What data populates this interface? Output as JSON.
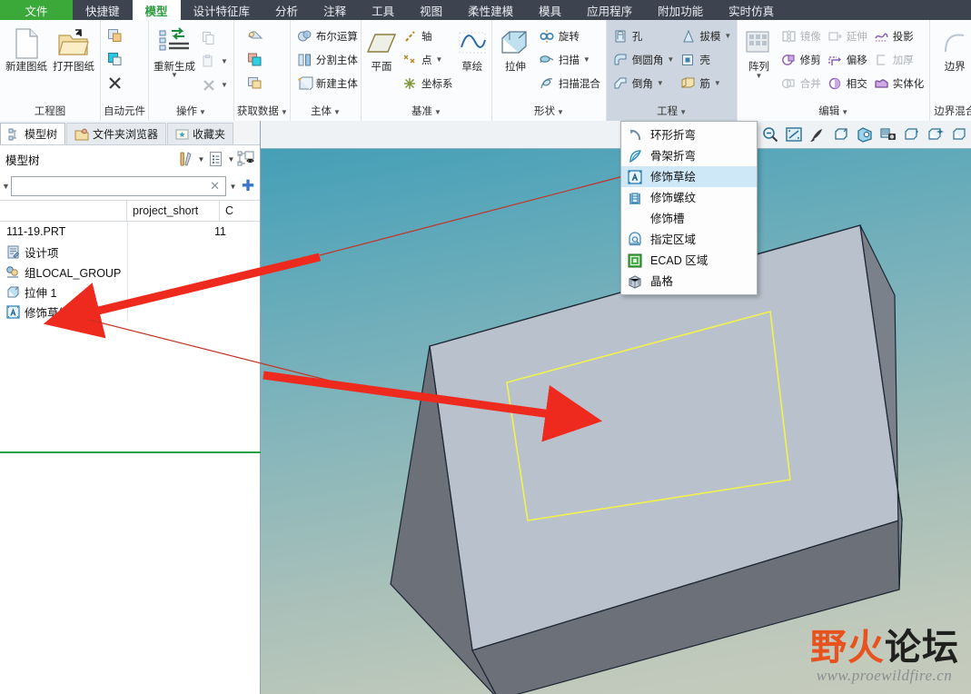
{
  "tabs": [
    {
      "label": "文件",
      "kind": "file"
    },
    {
      "label": "快捷键",
      "kind": "normal"
    },
    {
      "label": "模型",
      "kind": "active"
    },
    {
      "label": "设计特征库",
      "kind": "normal"
    },
    {
      "label": "分析",
      "kind": "normal"
    },
    {
      "label": "注释",
      "kind": "normal"
    },
    {
      "label": "工具",
      "kind": "normal"
    },
    {
      "label": "视图",
      "kind": "normal"
    },
    {
      "label": "柔性建模",
      "kind": "normal"
    },
    {
      "label": "模具",
      "kind": "normal"
    },
    {
      "label": "应用程序",
      "kind": "normal"
    },
    {
      "label": "附加功能",
      "kind": "normal"
    },
    {
      "label": "实时仿真",
      "kind": "normal"
    }
  ],
  "ribbon": {
    "groups": [
      {
        "name": "工程图",
        "caret": false,
        "big": [
          {
            "label": "新建图纸",
            "icon": "new-drawing-icon"
          },
          {
            "label": "打开图纸",
            "icon": "open-drawing-icon"
          }
        ]
      },
      {
        "name": "自动元件",
        "caret": false,
        "small": [
          {
            "label": "",
            "icon": "auto-place-icon"
          },
          {
            "label": "",
            "icon": "auto-create-icon"
          },
          {
            "label": "",
            "icon": "delete-x-icon"
          }
        ]
      },
      {
        "name": "操作",
        "caret": true,
        "small": [
          {
            "label": "重新生成",
            "icon": "regenerate-icon"
          }
        ],
        "small2": [
          {
            "label": "",
            "icon": "copy-icon",
            "disabled": true
          },
          {
            "label": "",
            "icon": "paste-icon",
            "disabled": true,
            "caret": true
          },
          {
            "label": "",
            "icon": "delete-x-icon",
            "disabled": true,
            "caret": true
          }
        ]
      },
      {
        "name": "获取数据",
        "caret": true,
        "small": [
          {
            "label": "",
            "icon": "get-data-1-icon"
          },
          {
            "label": "",
            "icon": "get-data-2-icon"
          },
          {
            "label": "",
            "icon": "get-data-3-icon"
          }
        ]
      },
      {
        "name": "主体",
        "caret": true,
        "small": [
          {
            "label": "布尔运算",
            "icon": "boolean-icon"
          },
          {
            "label": "分割主体",
            "icon": "split-body-icon"
          },
          {
            "label": "新建主体",
            "icon": "new-body-icon"
          }
        ]
      },
      {
        "name": "基准",
        "caret": true,
        "big": [
          {
            "label": "平面",
            "icon": "datum-plane-icon"
          }
        ],
        "small": [
          {
            "label": "轴",
            "icon": "datum-axis-icon"
          },
          {
            "label": "点",
            "icon": "datum-point-icon",
            "caret": true
          },
          {
            "label": "坐标系",
            "icon": "datum-csys-icon"
          }
        ],
        "big2": [
          {
            "label": "草绘",
            "icon": "sketch-icon"
          }
        ]
      },
      {
        "name": "形状",
        "caret": true,
        "big": [
          {
            "label": "拉伸",
            "icon": "extrude-icon"
          }
        ],
        "small": [
          {
            "label": "旋转",
            "icon": "revolve-icon"
          },
          {
            "label": "扫描",
            "icon": "sweep-icon",
            "caret": true
          },
          {
            "label": "扫描混合",
            "icon": "swept-blend-icon"
          }
        ]
      },
      {
        "name": "工程",
        "caret": true,
        "highlight": true,
        "small": [
          {
            "label": "孔",
            "icon": "hole-icon"
          },
          {
            "label": "倒圆角",
            "icon": "round-icon",
            "caret": true
          },
          {
            "label": "倒角",
            "icon": "chamfer-icon",
            "caret": true
          }
        ],
        "small2": [
          {
            "label": "拔模",
            "icon": "draft-icon",
            "caret": true
          },
          {
            "label": "壳",
            "icon": "shell-icon"
          },
          {
            "label": "筋",
            "icon": "rib-icon",
            "caret": true
          }
        ]
      },
      {
        "name": "编辑",
        "caret": true,
        "big": [
          {
            "label": "阵列",
            "icon": "pattern-icon",
            "caret": true
          }
        ],
        "small": [
          {
            "label": "镜像",
            "icon": "mirror-icon",
            "disabled": true
          },
          {
            "label": "修剪",
            "icon": "trim-icon"
          },
          {
            "label": "合并",
            "icon": "merge-icon",
            "disabled": true
          }
        ],
        "small2": [
          {
            "label": "延伸",
            "icon": "extend-icon",
            "disabled": true
          },
          {
            "label": "偏移",
            "icon": "offset-icon"
          },
          {
            "label": "相交",
            "icon": "intersect-icon"
          }
        ],
        "small3": [
          {
            "label": "投影",
            "icon": "project-icon"
          },
          {
            "label": "加厚",
            "icon": "thicken-icon",
            "disabled": true
          },
          {
            "label": "实体化",
            "icon": "solidify-icon"
          }
        ]
      },
      {
        "name": "边界混合",
        "caret": false,
        "big": [
          {
            "label": "边界",
            "icon": "boundary-blend-icon"
          }
        ]
      }
    ]
  },
  "leftpanel": {
    "tabs": [
      {
        "label": "模型树",
        "icon": "model-tree-icon",
        "active": true
      },
      {
        "label": "文件夹浏览器",
        "icon": "folder-browser-icon",
        "active": false
      },
      {
        "label": "收藏夹",
        "icon": "favorites-icon",
        "active": false
      }
    ],
    "header_title": "模型树",
    "tools": [
      {
        "name": "settings-tools-icon",
        "caret": true
      },
      {
        "name": "display-list-icon",
        "caret": true
      },
      {
        "name": "tree-filters-icon",
        "caret": false
      }
    ],
    "filter": {
      "value": "",
      "placeholder": ""
    },
    "columns": [
      "",
      "project_short",
      "C"
    ],
    "rows": [
      {
        "label": "111-19.PRT",
        "icon": "part-file-icon",
        "value": "11",
        "root": true
      },
      {
        "label": "设计项",
        "icon": "design-items-icon",
        "value": ""
      },
      {
        "label": "组LOCAL_GROUP",
        "icon": "group-icon",
        "value": ""
      },
      {
        "label": "拉伸 1",
        "icon": "extrude-feature-icon",
        "value": ""
      },
      {
        "label": "修饰草绘 1",
        "icon": "cosmetic-sketch-icon",
        "value": ""
      }
    ]
  },
  "graphics_toolbar": {
    "buttons": [
      {
        "name": "zoom-in-icon"
      },
      {
        "name": "zoom-out-icon"
      },
      {
        "name": "refit-icon"
      },
      {
        "name": "repaint-icon"
      },
      {
        "name": "display-style-icon"
      },
      {
        "name": "appearance-gallery-icon"
      },
      {
        "name": "saved-views-icon"
      },
      {
        "name": "datum-display-icon"
      },
      {
        "name": "spin-center-icon"
      },
      {
        "name": "annotation-display-icon"
      }
    ]
  },
  "menu": {
    "items": [
      {
        "label": "环形折弯",
        "icon": "toroidal-bend-icon",
        "selected": false
      },
      {
        "label": "骨架折弯",
        "icon": "spinal-bend-icon",
        "selected": false
      },
      {
        "label": "修饰草绘",
        "icon": "cosmetic-sketch-icon",
        "selected": true
      },
      {
        "label": "修饰螺纹",
        "icon": "cosmetic-thread-icon",
        "selected": false
      },
      {
        "label": "修饰槽",
        "icon": "cosmetic-groove-icon",
        "selected": false
      },
      {
        "label": "指定区域",
        "icon": "cosmetic-area-icon",
        "selected": false
      },
      {
        "label": "ECAD 区域",
        "icon": "ecad-area-icon",
        "selected": false
      },
      {
        "label": "晶格",
        "icon": "lattice-icon",
        "selected": false
      }
    ]
  },
  "watermark": {
    "char1": "野",
    "char2": "火",
    "char3": "论",
    "char4": "坛",
    "url": "www.proewildfire.cn"
  },
  "colors": {
    "tabbar_bg": "#3d4450",
    "file_tab": "#3aa93a",
    "active_tab_text": "#2d9c3f",
    "menu_selected": "#cfe8f7",
    "model_top_face": "#b9c1cd",
    "model_front_face": "#6b7079",
    "sketch_yellow": "#f2f24a",
    "arrow_red": "#ee2a1e",
    "insert_line_green": "#23a14a",
    "group_highlight": "#cdd6e0"
  }
}
